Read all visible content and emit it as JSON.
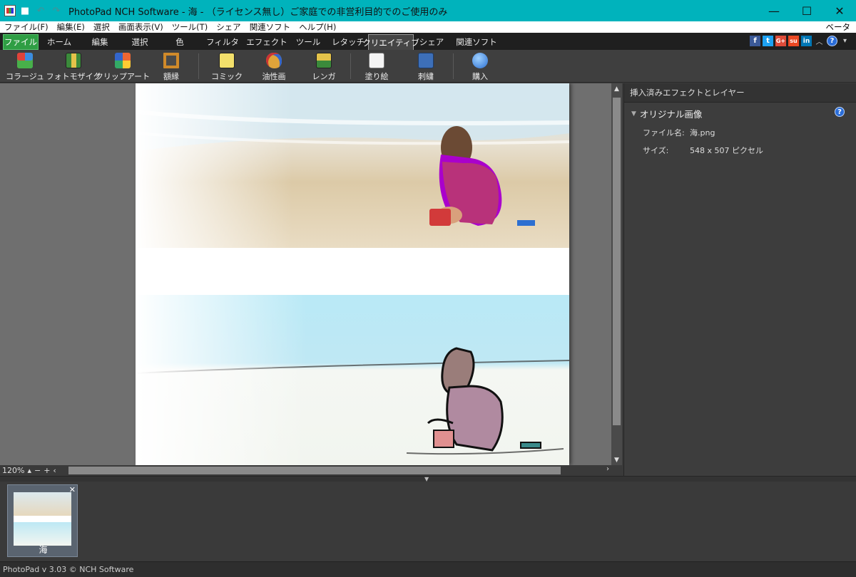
{
  "window": {
    "title": "PhotoPad NCH Software - 海 - （ライセンス無し）ご家庭での非営利目的でのご使用のみ",
    "minimize": "—",
    "maximize": "☐",
    "close": "✕"
  },
  "menubar": {
    "items": [
      "ファイル(F)",
      "編集(E)",
      "選択",
      "画面表示(V)",
      "ツール(T)",
      "シェア",
      "関連ソフト",
      "ヘルプ(H)"
    ],
    "beta": "ベータ"
  },
  "tabs": {
    "items": [
      "ファイル",
      "ホーム",
      "編集",
      "選択",
      "色",
      "フィルタ",
      "エフェクト",
      "ツール",
      "レタッチ",
      "クリエイティブ",
      "シェア",
      "関連ソフト"
    ],
    "active": "クリエイティブ"
  },
  "social": {
    "facebook": "f",
    "twitter": "t",
    "googleplus": "G+",
    "stumbleupon": "su",
    "linkedin": "in",
    "collapse": "︿",
    "help": "?",
    "more": "▾"
  },
  "toolbar": {
    "collage": "コラージュ",
    "photomosaic": "フォトモザイク",
    "clipart": "クリップアート",
    "frame": "額縁",
    "comic": "コミック",
    "oilpaint": "油性画",
    "brick": "レンガ",
    "paintbynumber": "塗り絵",
    "embroidery": "刺繍",
    "buy": "購入"
  },
  "zoom": {
    "value": "120%",
    "up": "▴",
    "minus": "−",
    "plus": "+",
    "left": "‹",
    "right": "›"
  },
  "right_panel": {
    "header": "挿入済みエフェクトとレイヤー",
    "section": "オリジナル画像",
    "filename_label": "ファイル名:",
    "filename": "海.png",
    "size_label": "サイズ:",
    "size": "548 x 507 ピクセル"
  },
  "filmstrip": {
    "thumb_label": "海",
    "close": "✕"
  },
  "status": "PhotoPad v 3.03 © NCH Software",
  "colors": {
    "titlebar": "#00b3bc",
    "file_tab": "#2f9e44",
    "workspace": "#6f6f6f"
  }
}
